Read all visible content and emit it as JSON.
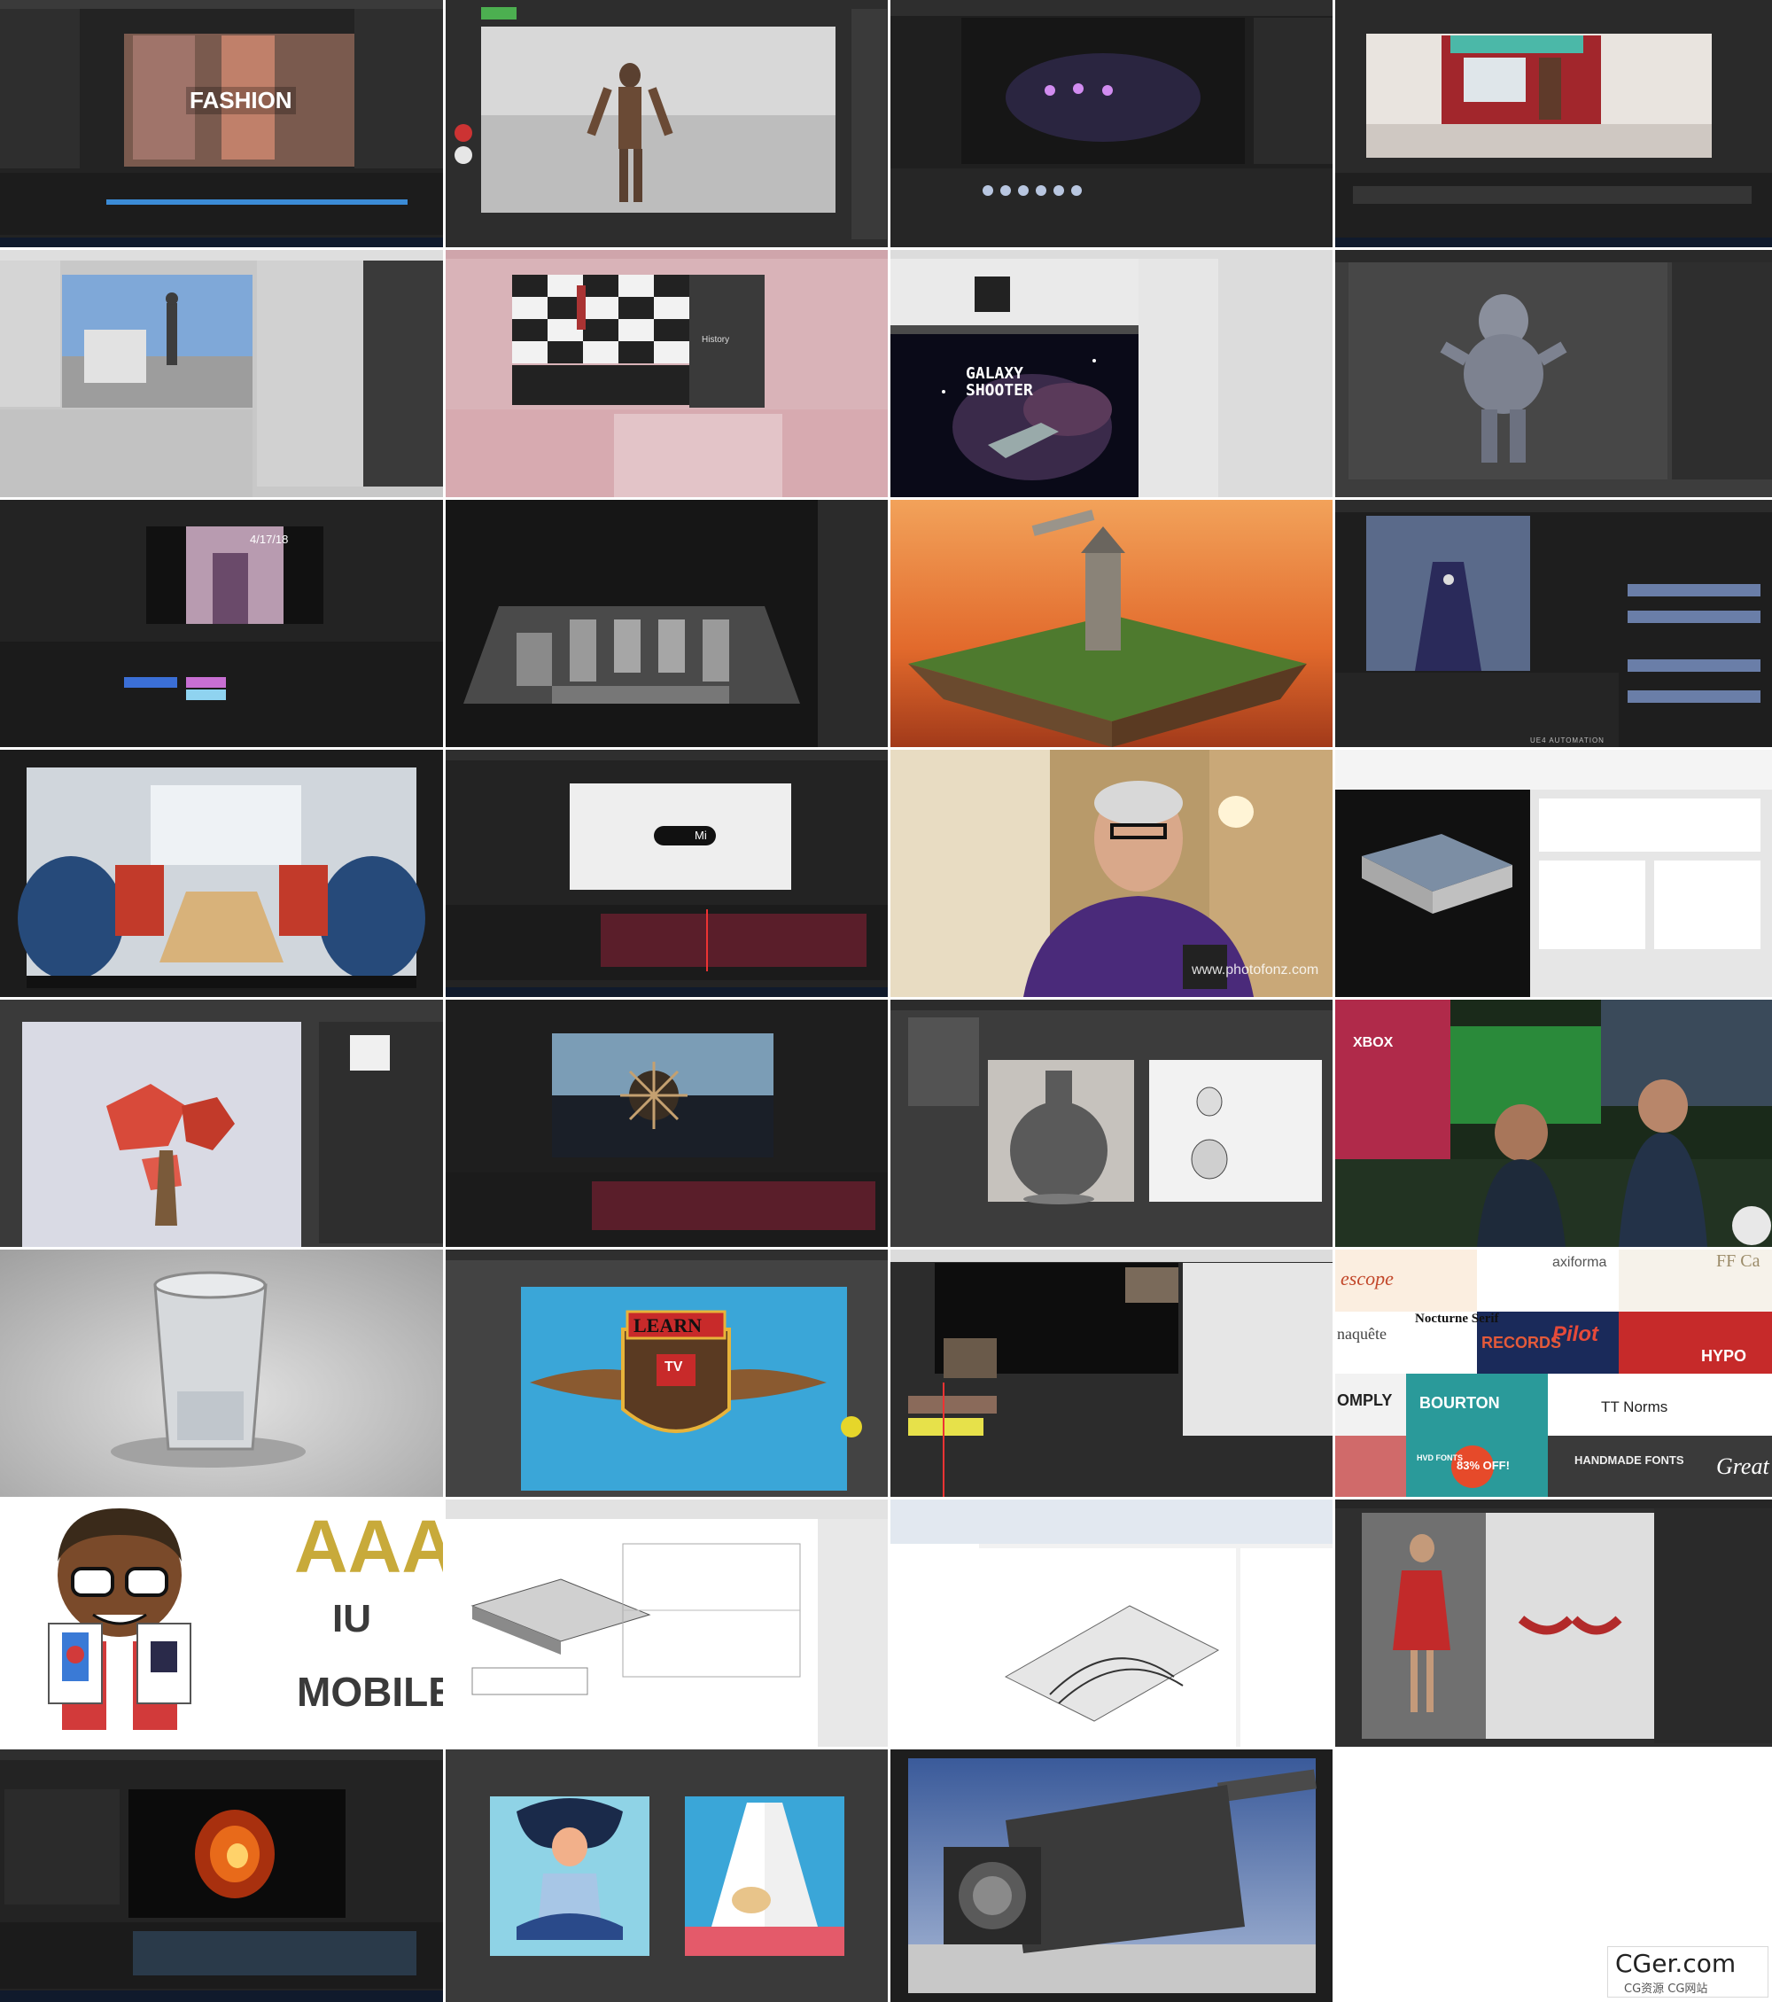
{
  "thumbnails": {
    "fashion": {
      "title": "FASHION"
    },
    "galaxy": {
      "title": "GALAXY SHOOTER"
    },
    "history": {
      "label": "History"
    },
    "date": {
      "text": "4/17/18"
    },
    "ui_automation": {
      "label": "UE4 AUTOMATION"
    },
    "presenter": {
      "url": "www.photofonz.com"
    },
    "mi": {
      "text": "Mi"
    },
    "learn_tv": {
      "top": "LEARN",
      "bottom": "TV"
    },
    "aaa": {
      "line1": "AAA",
      "line2": "IU",
      "line3": "MOBILE"
    },
    "fonts": {
      "items": [
        "escope",
        "axiforma",
        "FF Ca",
        "naquête",
        "Nocturne Serif",
        "RECORDS",
        "Pilot",
        "HYPO",
        "OMPLY",
        "BOURTON",
        "TT Norms",
        "HVD FONTS",
        "83% OFF!",
        "HANDMADE FONTS",
        "Great"
      ]
    },
    "xbox": {
      "label": "XBOX"
    }
  },
  "watermark": {
    "line1": "CGer.com",
    "line2": "CG资源 CG网站"
  },
  "colors": {
    "dark_ui": "#2b2b2b",
    "pink_ui": "#d9b3b8",
    "sunset": "#e26a2c",
    "learn_sky": "#3aa6d8"
  }
}
